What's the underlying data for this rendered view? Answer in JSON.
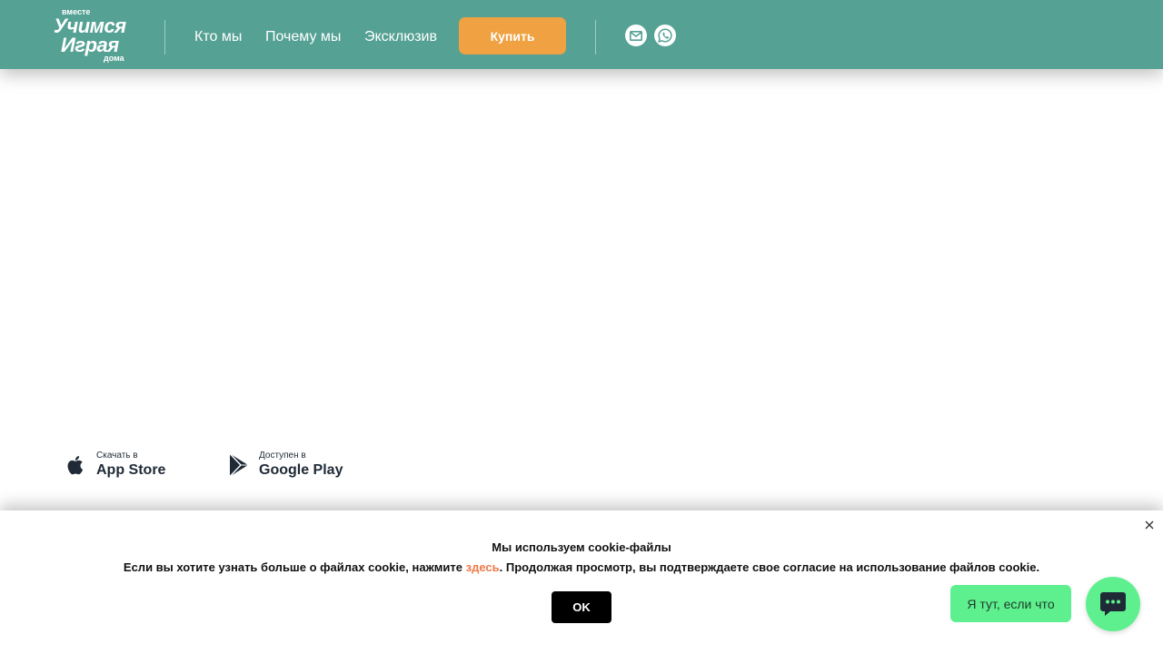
{
  "logo": {
    "line1": "вместе",
    "line2": "Учимся",
    "line3": "Играя",
    "line4": "дома"
  },
  "nav": {
    "items": [
      {
        "label": "Кто мы"
      },
      {
        "label": "Почему мы"
      },
      {
        "label": "Эксклюзив"
      }
    ],
    "buy_label": "Купить"
  },
  "social": {
    "icons": [
      "mail-icon",
      "whatsapp-icon"
    ]
  },
  "stores": {
    "apple": {
      "small": "Скачать в",
      "large": "App Store"
    },
    "google": {
      "small": "Доступен в",
      "large": "Google Play"
    }
  },
  "cookie": {
    "title": "Мы используем cookie-файлы",
    "text_before": "Если вы хотите узнать больше о файлах cookie, нажмите ",
    "link": "здесь",
    "text_after": ". Продолжая просмотр, вы подтверждаете свое согласие на использование файлов cookie.",
    "ok_label": "OK"
  },
  "chat": {
    "bubble_text": "Я тут, если что"
  },
  "colors": {
    "header": "#55a194",
    "buy": "#f0a142",
    "chat": "#5ef08e",
    "link": "#f07a4a"
  }
}
